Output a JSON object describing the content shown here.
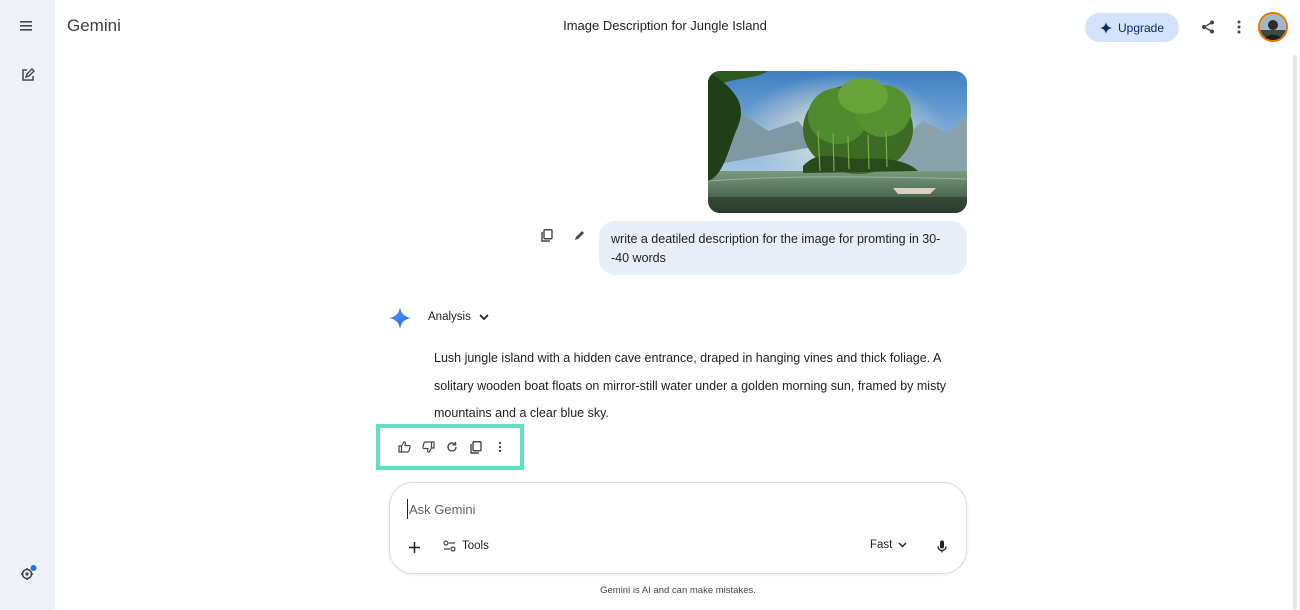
{
  "app": {
    "brand": "Gemini",
    "chat_title": "Image Description for Jungle Island",
    "upgrade_label": "Upgrade"
  },
  "conversation": {
    "user_prompt": "write a deatiled description for the image for promting in 30--40 words",
    "model_mode_label": "Analysis",
    "response_text": "Lush jungle island with a hidden cave entrance, draped in hanging vines and thick foliage. A solitary wooden boat floats on mirror-still water under a golden morning sun, framed by misty mountains and a clear blue sky."
  },
  "composer": {
    "placeholder": "Ask Gemini",
    "tools_label": "Tools",
    "model_label": "Fast"
  },
  "footer": {
    "disclaimer": "Gemini is AI and can make mistakes."
  },
  "icons": {
    "menu": "menu-icon",
    "new_chat": "edit-icon",
    "settings": "gear-icon",
    "share": "share-icon",
    "more": "more-vert-icon",
    "spark": "gemini-spark-icon",
    "thumbs_up": "thumbs-up-icon",
    "thumbs_down": "thumbs-down-icon",
    "regenerate": "refresh-icon",
    "copy": "copy-icon",
    "plus": "plus-icon",
    "mic": "mic-icon"
  },
  "colors": {
    "sidebar_bg": "#eef1f7",
    "upgrade_bg": "#d3e3fd",
    "user_bubble_bg": "#e9eef6",
    "highlight_box": "#5ee0c3",
    "spark_blue": "#4285f4"
  }
}
